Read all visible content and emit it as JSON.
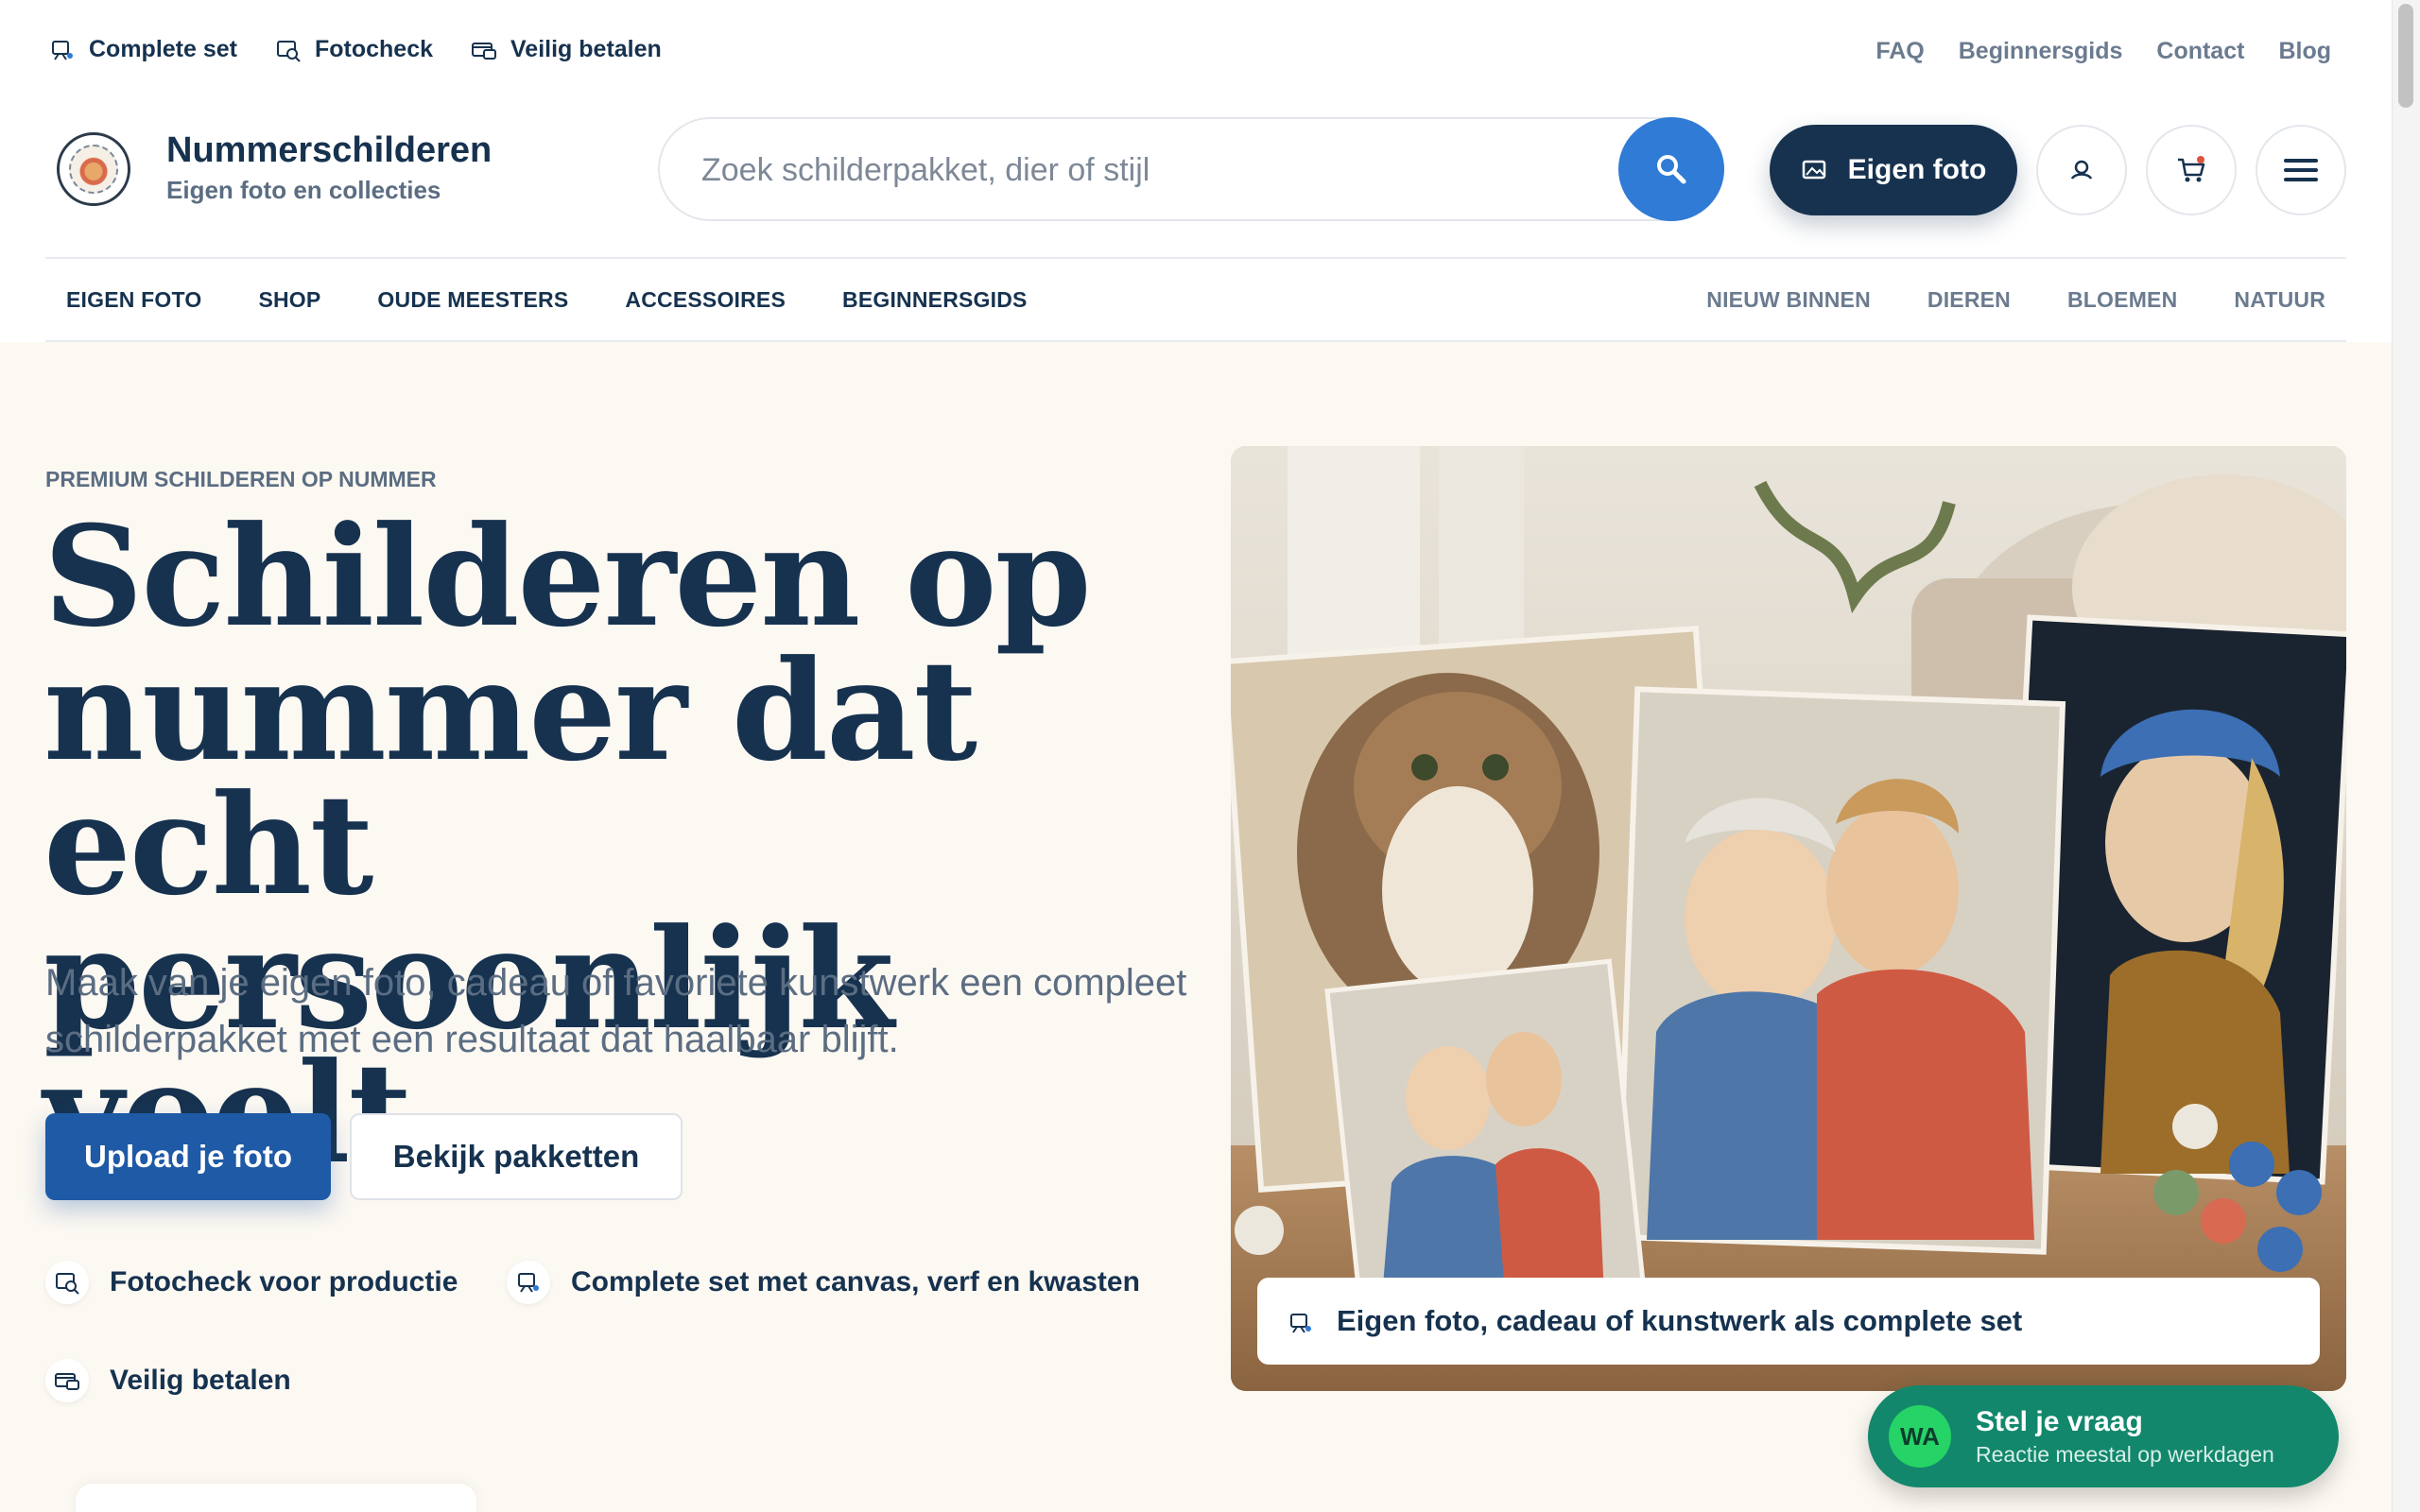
{
  "topbar": {
    "left": [
      {
        "label": "Complete set",
        "icon": "easel-icon"
      },
      {
        "label": "Fotocheck",
        "icon": "photo-check-icon"
      },
      {
        "label": "Veilig betalen",
        "icon": "card-icon"
      }
    ],
    "right": [
      "FAQ",
      "Beginnersgids",
      "Contact",
      "Blog"
    ]
  },
  "header": {
    "brand_name": "Nummerschilderen",
    "brand_sub": "Eigen foto en collecties",
    "search_placeholder": "Zoek schilderpakket, dier of stijl",
    "eigen_foto_label": "Eigen foto"
  },
  "nav": {
    "left": [
      "EIGEN FOTO",
      "SHOP",
      "OUDE MEESTERS",
      "ACCESSOIRES",
      "BEGINNERSGIDS"
    ],
    "right": [
      "NIEUW BINNEN",
      "DIEREN",
      "BLOEMEN",
      "NATUUR"
    ]
  },
  "hero": {
    "eyebrow": "PREMIUM SCHILDEREN OP NUMMER",
    "title": "Schilderen op nummer dat echt persoonlijk voelt",
    "text": "Maak van je eigen foto, cadeau of favoriete kunstwerk een compleet schilderpakket met een resultaat dat haalbaar blijft.",
    "primary_button": "Upload je foto",
    "secondary_button": "Bekijk pakketten",
    "features": [
      {
        "label": "Fotocheck voor productie",
        "icon": "photo-check-icon"
      },
      {
        "label": "Complete set met canvas, verf en kwasten",
        "icon": "easel-icon"
      },
      {
        "label": "Veilig betalen",
        "icon": "card-icon"
      }
    ],
    "image_caption": "Eigen foto, cadeau of kunstwerk als complete set"
  },
  "whatsapp": {
    "badge": "WA",
    "title": "Stel je vraag",
    "subtitle": "Reactie meestal op werkdagen"
  },
  "colors": {
    "navy": "#16324f",
    "blue": "#2f7bd6",
    "button_blue": "#1f5aa6",
    "hero_bg": "#fcf8f2",
    "whatsapp_green": "#12876c"
  }
}
